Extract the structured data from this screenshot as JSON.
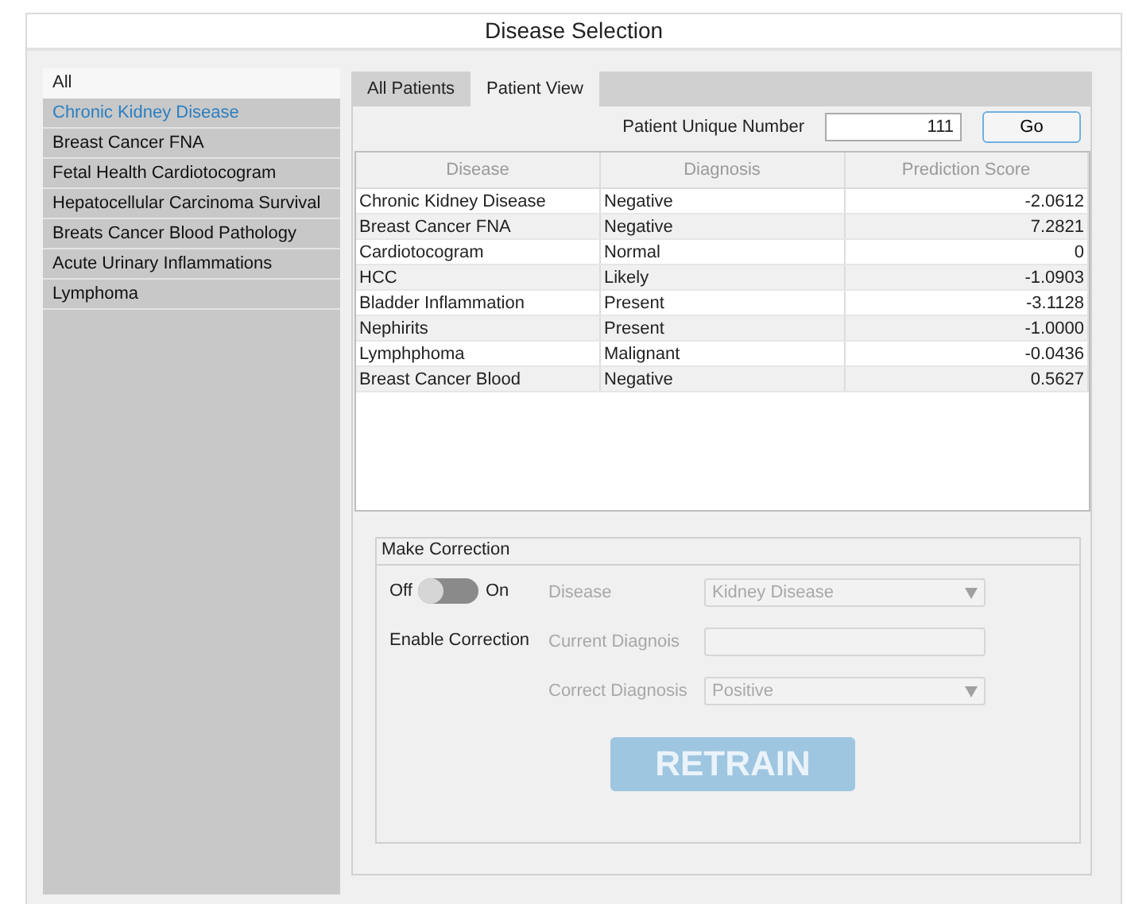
{
  "window": {
    "title": "Disease Selection"
  },
  "sidebar": {
    "header": "All",
    "items": [
      {
        "label": "Chronic Kidney Disease",
        "selected": true
      },
      {
        "label": "Breast Cancer FNA",
        "selected": false
      },
      {
        "label": "Fetal Health Cardiotocogram",
        "selected": false
      },
      {
        "label": "Hepatocellular Carcinoma Survival",
        "selected": false
      },
      {
        "label": "Breats Cancer Blood Pathology",
        "selected": false
      },
      {
        "label": "Acute Urinary Inflammations",
        "selected": false
      },
      {
        "label": "Lymphoma",
        "selected": false
      }
    ]
  },
  "tabs": [
    {
      "label": "All Patients",
      "selected": false
    },
    {
      "label": "Patient View",
      "selected": true
    }
  ],
  "patient": {
    "label": "Patient Unique Number",
    "value": "111",
    "button": "Go"
  },
  "table": {
    "columns": [
      "Disease",
      "Diagnosis",
      "Prediction Score"
    ],
    "rows": [
      [
        "Chronic Kidney Disease",
        "Negative",
        "-2.0612"
      ],
      [
        "Breast Cancer FNA",
        "Negative",
        "7.2821"
      ],
      [
        "Cardiotocogram",
        "Normal",
        "0"
      ],
      [
        "HCC",
        "Likely",
        "-1.0903"
      ],
      [
        "Bladder Inflammation",
        "Present",
        "-3.1128"
      ],
      [
        "Nephirits",
        "Present",
        "-1.0000"
      ],
      [
        "Lymphphoma",
        "Malignant",
        "-0.0436"
      ],
      [
        "Breast Cancer Blood",
        "Negative",
        "0.5627"
      ]
    ]
  },
  "correction": {
    "title": "Make Correction",
    "toggle": {
      "off_label": "Off",
      "on_label": "On",
      "on": false,
      "caption": "Enable Correction"
    },
    "fields": [
      {
        "kind": "dropdown",
        "label": "Disease",
        "value": "Kidney Disease",
        "disabled": true
      },
      {
        "kind": "text",
        "label": "Current Diagnois",
        "disabled": true
      },
      {
        "kind": "dropdown",
        "label": "Correct Diagnosis",
        "value": "Positive",
        "disabled": true
      }
    ],
    "button": {
      "label": "RETRAIN",
      "disabled": true
    }
  }
}
